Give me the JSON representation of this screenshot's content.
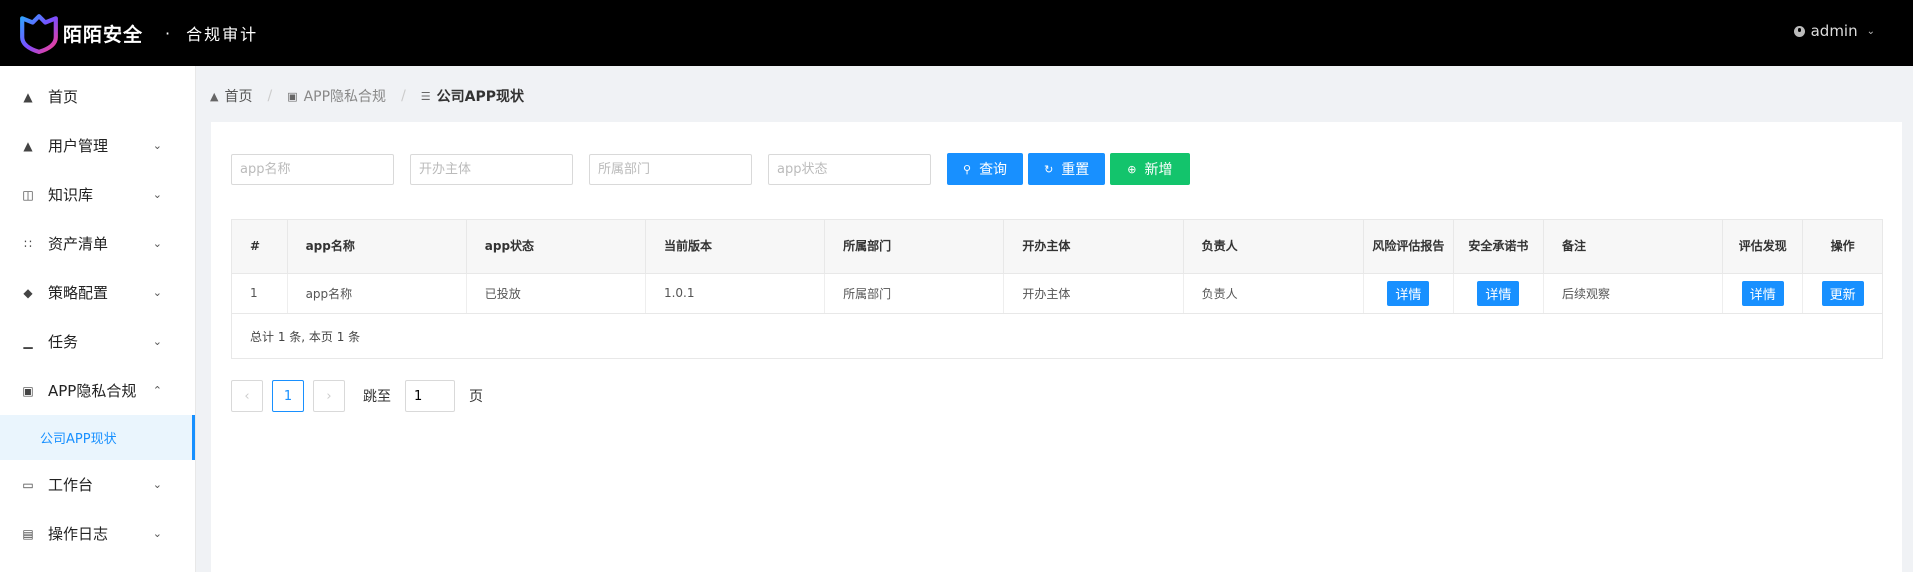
{
  "header": {
    "brand": "陌陌安全",
    "separator": "·",
    "subtitle": "合规审计",
    "user": "admin"
  },
  "sidebar": {
    "items": [
      {
        "label": "首页",
        "icon": "home-icon"
      },
      {
        "label": "用户管理",
        "icon": "home-icon"
      },
      {
        "label": "知识库",
        "icon": "book-icon"
      },
      {
        "label": "资产清单",
        "icon": "grid-icon"
      },
      {
        "label": "策略配置",
        "icon": "cube-icon"
      },
      {
        "label": "任务",
        "icon": "bar-chart-icon"
      },
      {
        "label": "APP隐私合规",
        "icon": "briefcase-icon"
      },
      {
        "label": "公司APP现状"
      },
      {
        "label": "工作台",
        "icon": "desktop-icon"
      },
      {
        "label": "操作日志",
        "icon": "log-icon"
      }
    ]
  },
  "breadcrumb": {
    "home": "首页",
    "section": "APP隐私合规",
    "current": "公司APP现状"
  },
  "filters": {
    "app_name_placeholder": "app名称",
    "operator_placeholder": "开办主体",
    "department_placeholder": "所属部门",
    "status_placeholder": "app状态",
    "query_label": "查询",
    "reset_label": "重置",
    "add_label": "新增"
  },
  "table": {
    "columns": [
      "#",
      "app名称",
      "app状态",
      "当前版本",
      "所属部门",
      "开办主体",
      "负责人",
      "风险评估报告",
      "安全承诺书",
      "备注",
      "评估发现",
      "操作"
    ],
    "rows": [
      {
        "index": "1",
        "app_name": "app名称",
        "status": "已投放",
        "version": "1.0.1",
        "department": "所属部门",
        "operator": "开办主体",
        "owner": "负责人",
        "risk_report": "详情",
        "commitment": "详情",
        "remark": "后续观察",
        "findings": "详情",
        "action": "更新"
      }
    ],
    "summary": "总计 1 条, 本页 1 条"
  },
  "pagination": {
    "current_page": "1",
    "jump_label": "跳至",
    "jump_value": "1",
    "page_suffix": "页"
  },
  "colors": {
    "primary": "#1890ff",
    "success": "#13c46c",
    "header_bg": "#000000"
  }
}
